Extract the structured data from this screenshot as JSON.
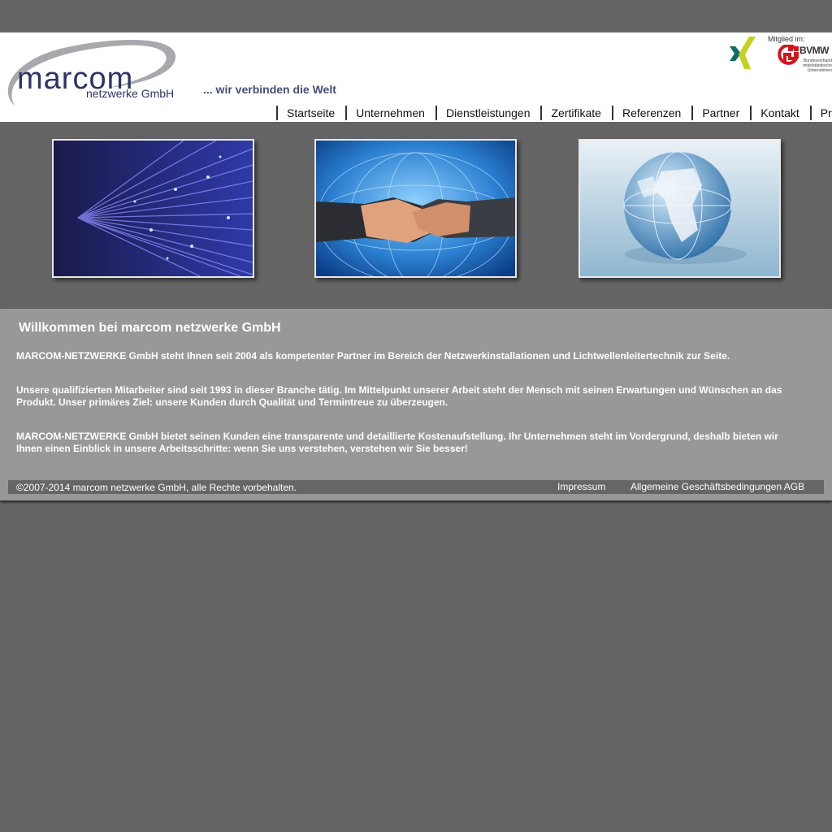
{
  "brand": {
    "logo_main": "marcom",
    "logo_sub": "netzwerke GmbH",
    "tagline": "... wir verbinden die Welt"
  },
  "badges": {
    "bvmw_label": "Mitglied im:",
    "bvmw_name": "BVMW",
    "bvmw_sub": "Bundesverband mittelständische Unternehmen"
  },
  "nav": {
    "items": [
      "Startseite",
      "Unternehmen",
      "Dienstleistungen",
      "Zertifikate",
      "Referenzen",
      "Partner",
      "Kontakt",
      "Presse"
    ]
  },
  "content": {
    "title": "Willkommen bei marcom netzwerke GmbH",
    "paragraphs": [
      "MARCOM-NETZWERKE GmbH steht Ihnen seit 2004 als kompetenter Partner im Bereich der Netzwerkinstallationen und Lichtwellenleitertechnik zur Seite.",
      "Unsere qualifizierten Mitarbeiter sind seit 1993 in dieser Branche tätig. Im Mittelpunkt unserer Arbeit steht der Mensch mit seinen Erwartungen und Wünschen an das Produkt. Unser primäres Ziel: unsere Kunden durch Qualität und Termintreue zu überzeugen.",
      "MARCOM-NETZWERKE GmbH bietet seinen Kunden eine transparente und detaillierte Kostenaufstellung. Ihr Unternehmen steht im Vordergrund, deshalb bieten wir Ihnen einen Einblick in unsere Arbeitsschritte: wenn Sie uns verstehen, verstehen wir Sie besser!"
    ]
  },
  "footer": {
    "copyright": "©2007-2014 marcom netzwerke GmbH, alle Rechte vorbehalten.",
    "impressum": "Impressum",
    "agb": "Allgemeine Geschäftsbedingungen AGB"
  },
  "colors": {
    "page_background": "#656565",
    "brand_blue": "#2c3566",
    "content_background": "#989898",
    "xing_green": "#c4d21b",
    "xing_teal": "#0b6c6a",
    "bvmw_red": "#d6141c"
  },
  "icons": {
    "xing": "xing-icon",
    "bvmw": "bvmw-logo"
  }
}
